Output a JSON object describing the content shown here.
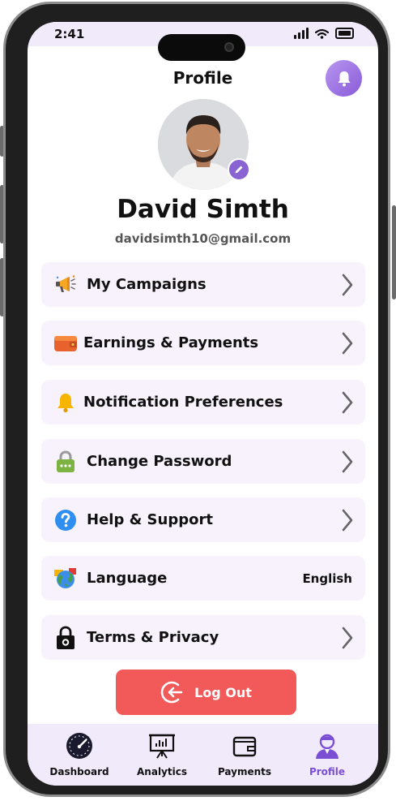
{
  "status_bar": {
    "time": "2:41"
  },
  "header": {
    "title": "Profile"
  },
  "profile": {
    "name": "David Simth",
    "email": "davidsimth10@gmail.com"
  },
  "menu": [
    {
      "label": "My Campaigns",
      "icon": "megaphone-icon"
    },
    {
      "label": "Earnings & Payments",
      "icon": "wallet-icon"
    },
    {
      "label": "Notification Preferences",
      "icon": "bell-icon"
    },
    {
      "label": "Change Password",
      "icon": "lock-icon"
    },
    {
      "label": "Help & Support",
      "icon": "help-icon"
    },
    {
      "label": "Language",
      "icon": "globe-icon",
      "value": "English"
    },
    {
      "label": "Terms & Privacy",
      "icon": "padlock-icon"
    }
  ],
  "logout": {
    "label": "Log Out"
  },
  "tabs": [
    {
      "label": "Dashboard",
      "icon": "speedometer-icon"
    },
    {
      "label": "Analytics",
      "icon": "presentation-chart-icon"
    },
    {
      "label": "Payments",
      "icon": "wallet-icon"
    },
    {
      "label": "Profile",
      "icon": "user-icon",
      "active": true
    }
  ],
  "colors": {
    "accent": "#8a5ad8",
    "logout": "#f25a5a",
    "card": "#f7f2fc",
    "bar": "#f1eafa",
    "active_tab": "#7a4fd3"
  }
}
